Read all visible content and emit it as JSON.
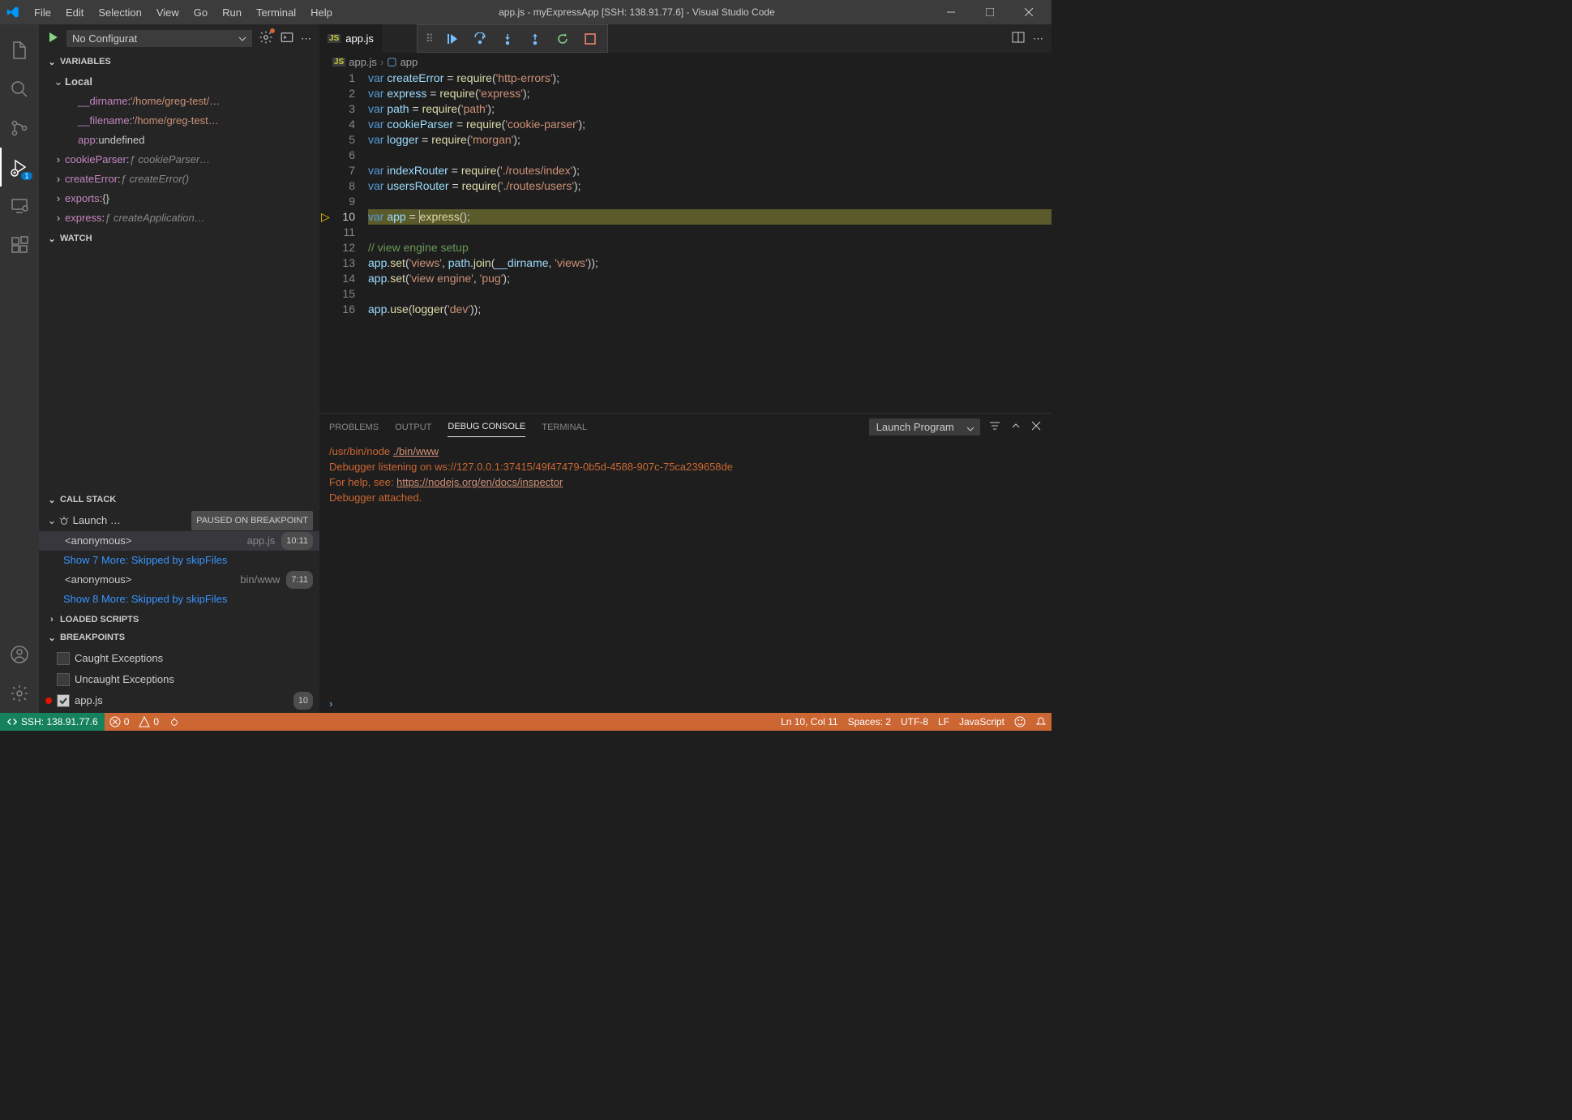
{
  "window": {
    "title": "app.js - myExpressApp [SSH: 138.91.77.6] - Visual Studio Code"
  },
  "menu": [
    "File",
    "Edit",
    "Selection",
    "View",
    "Go",
    "Run",
    "Terminal",
    "Help"
  ],
  "debug": {
    "config": "No Configurat",
    "badge": "1"
  },
  "variables": {
    "title": "VARIABLES",
    "scope": "Local",
    "items": [
      {
        "name": "__dirname",
        "value": "'/home/greg-test/…",
        "type": "str"
      },
      {
        "name": "__filename",
        "value": "'/home/greg-test…",
        "type": "str"
      },
      {
        "name": "app",
        "value": "undefined",
        "type": "val"
      },
      {
        "name": "cookieParser",
        "value": "ƒ cookieParser…",
        "type": "func",
        "expandable": true
      },
      {
        "name": "createError",
        "value": "ƒ createError()",
        "type": "func",
        "expandable": true
      },
      {
        "name": "exports",
        "value": "{}",
        "type": "val",
        "expandable": true
      },
      {
        "name": "express",
        "value": "ƒ createApplication…",
        "type": "func",
        "expandable": true
      }
    ]
  },
  "watch": {
    "title": "WATCH"
  },
  "callstack": {
    "title": "CALL STACK",
    "session": "Launch …",
    "status": "PAUSED ON BREAKPOINT",
    "frames": [
      {
        "func": "<anonymous>",
        "file": "app.js",
        "line": "10:11",
        "selected": true
      },
      {
        "skip": "Show 7 More: Skipped by skipFiles"
      },
      {
        "func": "<anonymous>",
        "file": "bin/www",
        "line": "7:11"
      },
      {
        "skip": "Show 8 More: Skipped by skipFiles"
      }
    ]
  },
  "loaded": {
    "title": "LOADED SCRIPTS"
  },
  "breakpoints": {
    "title": "BREAKPOINTS",
    "items": [
      {
        "label": "Caught Exceptions",
        "checked": false
      },
      {
        "label": "Uncaught Exceptions",
        "checked": false
      },
      {
        "label": "app.js",
        "checked": true,
        "dot": true,
        "count": "10"
      }
    ]
  },
  "editor": {
    "tab": "app.js",
    "breadcrumb": {
      "file": "app.js",
      "symbol": "app"
    },
    "currentLine": 10,
    "lines": [
      {
        "n": 1,
        "html": "<span class='tok-kw'>var</span> <span class='tok-var'>createError</span> <span class='tok-op'>=</span> <span class='tok-fn'>require</span>(<span class='tok-str'>'http-errors'</span>);"
      },
      {
        "n": 2,
        "html": "<span class='tok-kw'>var</span> <span class='tok-var'>express</span> <span class='tok-op'>=</span> <span class='tok-fn'>require</span>(<span class='tok-str'>'express'</span>);"
      },
      {
        "n": 3,
        "html": "<span class='tok-kw'>var</span> <span class='tok-var'>path</span> <span class='tok-op'>=</span> <span class='tok-fn'>require</span>(<span class='tok-str'>'path'</span>);"
      },
      {
        "n": 4,
        "html": "<span class='tok-kw'>var</span> <span class='tok-var'>cookieParser</span> <span class='tok-op'>=</span> <span class='tok-fn'>require</span>(<span class='tok-str'>'cookie-parser'</span>);"
      },
      {
        "n": 5,
        "html": "<span class='tok-kw'>var</span> <span class='tok-var'>logger</span> <span class='tok-op'>=</span> <span class='tok-fn'>require</span>(<span class='tok-str'>'morgan'</span>);"
      },
      {
        "n": 6,
        "html": ""
      },
      {
        "n": 7,
        "html": "<span class='tok-kw'>var</span> <span class='tok-var'>indexRouter</span> <span class='tok-op'>=</span> <span class='tok-fn'>require</span>(<span class='tok-str'>'./routes/index'</span>);"
      },
      {
        "n": 8,
        "html": "<span class='tok-kw'>var</span> <span class='tok-var'>usersRouter</span> <span class='tok-op'>=</span> <span class='tok-fn'>require</span>(<span class='tok-str'>'./routes/users'</span>);"
      },
      {
        "n": 9,
        "html": ""
      },
      {
        "n": 10,
        "html": "<span class='tok-kw'>var</span> <span class='tok-var'>app</span> <span class='tok-op'>=</span> <span class='cursor-mark'></span><span class='tok-fn'>express</span>();"
      },
      {
        "n": 11,
        "html": ""
      },
      {
        "n": 12,
        "html": "<span class='tok-com'>// view engine setup</span>"
      },
      {
        "n": 13,
        "html": "<span class='tok-var'>app</span>.<span class='tok-fn'>set</span>(<span class='tok-str'>'views'</span>, <span class='tok-var'>path</span>.<span class='tok-fn'>join</span>(<span class='tok-var'>__dirname</span>, <span class='tok-str'>'views'</span>));"
      },
      {
        "n": 14,
        "html": "<span class='tok-var'>app</span>.<span class='tok-fn'>set</span>(<span class='tok-str'>'view engine'</span>, <span class='tok-str'>'pug'</span>);"
      },
      {
        "n": 15,
        "html": ""
      },
      {
        "n": 16,
        "html": "<span class='tok-var'>app</span>.<span class='tok-fn'>use</span>(<span class='tok-fn'>logger</span>(<span class='tok-str'>'dev'</span>));"
      }
    ]
  },
  "panel": {
    "tabs": [
      "PROBLEMS",
      "OUTPUT",
      "DEBUG CONSOLE",
      "TERMINAL"
    ],
    "active": "DEBUG CONSOLE",
    "selector": "Launch Program",
    "console": {
      "line1a": "/usr/bin/node ",
      "line1b": "./bin/www",
      "line2": "Debugger listening on ws://127.0.0.1:37415/49f47479-0b5d-4588-907c-75ca239658de",
      "line3a": "For help, see: ",
      "line3b": "https://nodejs.org/en/docs/inspector",
      "line4": "Debugger attached."
    }
  },
  "status": {
    "remote": "SSH: 138.91.77.6",
    "errors": "0",
    "warnings": "0",
    "pos": "Ln 10, Col 11",
    "spaces": "Spaces: 2",
    "encoding": "UTF-8",
    "eol": "LF",
    "lang": "JavaScript"
  }
}
